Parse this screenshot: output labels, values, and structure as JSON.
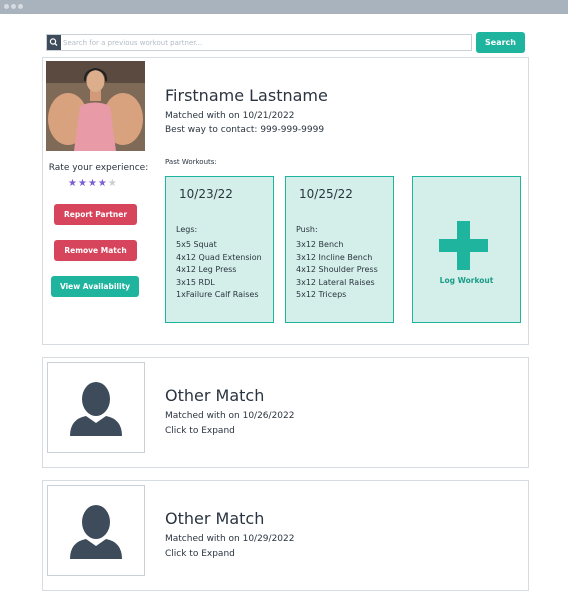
{
  "search": {
    "placeholder": "Search for a previous workout partner...",
    "button_label": "Search"
  },
  "profile": {
    "name": "Firstname Lastname",
    "matched": "Matched with on 10/21/2022",
    "contact": "Best way to contact: 999-999-9999",
    "rate_label": "Rate your experience:",
    "rating": {
      "value": 4,
      "max": 5
    },
    "buttons": {
      "report": "Report Partner",
      "remove": "Remove Match",
      "availability": "View Availability"
    },
    "past_label": "Past Workouts:",
    "workouts": [
      {
        "date": "10/23/22",
        "type": "Legs:",
        "lines": [
          "5x5 Squat",
          "4x12 Quad Extension",
          "4x12 Leg Press",
          "3x15 RDL",
          "1xFailure Calf Raises"
        ]
      },
      {
        "date": "10/25/22",
        "type": "Push:",
        "lines": [
          "3x12 Bench",
          "3x12 Incline Bench",
          "4x12 Shoulder Press",
          "3x12 Lateral Raises",
          "5x12 Triceps"
        ]
      }
    ],
    "log_label": "Log Workout"
  },
  "other_matches": [
    {
      "name": "Other Match",
      "matched": "Matched with on 10/26/2022",
      "action": "Click to Expand"
    },
    {
      "name": "Other Match",
      "matched": "Matched with on 10/29/2022",
      "action": "Click to Expand"
    }
  ],
  "colors": {
    "teal": "#1fb49e",
    "red": "#d7455c",
    "star": "#7b5ed6",
    "dark": "#3d4b5a"
  }
}
